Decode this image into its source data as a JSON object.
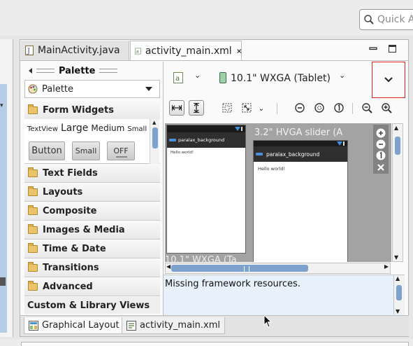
{
  "quick_access": {
    "placeholder": "Quick Ac"
  },
  "tabs": [
    {
      "label": "MainActivity.java"
    },
    {
      "label": "activity_main.xml"
    }
  ],
  "palette": {
    "header": "Palette",
    "selector": "Palette",
    "categories": [
      "Form Widgets",
      "Text Fields",
      "Layouts",
      "Composite",
      "Images & Media",
      "Time & Date",
      "Transitions",
      "Advanced"
    ],
    "form_widgets": {
      "textview": "TextView",
      "large": "Large",
      "medium": "Medium",
      "small": "Small",
      "button": "Button",
      "small_button": "Small",
      "toggle": "OFF"
    },
    "custom_views": "Custom & Library Views"
  },
  "config": {
    "device": "10.1\" WXGA (Tablet)"
  },
  "canvas": {
    "device1_title": "paralax_background",
    "device1_hello": "Hello world!",
    "device1_label": "10.1\" WXGA (Ta",
    "device2_label": "3.2\" HVGA slider (A",
    "device2_title": "paralax_background",
    "device2_hello": "Hello world!"
  },
  "console": {
    "message": "Missing framework resources."
  },
  "bottom_tabs": [
    {
      "label": "Graphical Layout"
    },
    {
      "label": "activity_main.xml"
    }
  ],
  "colors": {
    "highlight_box": "#dd2222",
    "scroll_thumb": "#7da2ce",
    "console_bg": "#e7f1fb",
    "canvas_bg": "#a3a3a3"
  }
}
